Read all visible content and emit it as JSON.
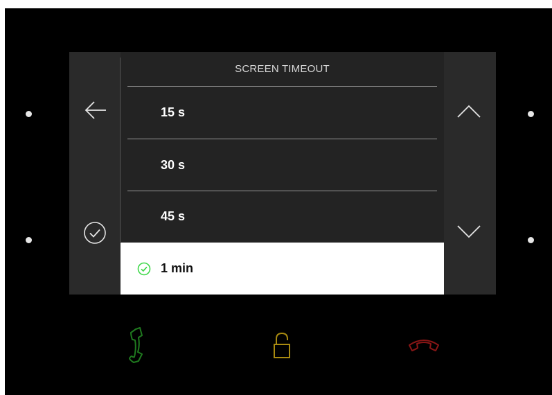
{
  "screen": {
    "title": "SCREEN TIMEOUT",
    "options": [
      {
        "label": "15 s",
        "selected": false
      },
      {
        "label": "30 s",
        "selected": false
      },
      {
        "label": "45 s",
        "selected": false
      },
      {
        "label": "1 min",
        "selected": true
      }
    ]
  },
  "controls": {
    "back_icon": "arrow-left-icon",
    "confirm_icon": "check-circle-icon",
    "scroll_up_icon": "chevron-up-icon",
    "scroll_down_icon": "chevron-down-icon"
  },
  "hardware_buttons": {
    "answer_icon": "phone-answer-icon",
    "unlock_icon": "unlock-icon",
    "hangup_icon": "phone-hangup-icon"
  },
  "colors": {
    "selected_check": "#3fd84a",
    "answer": "#1f7a1f",
    "unlock": "#a88a10",
    "hangup": "#8a1616"
  }
}
